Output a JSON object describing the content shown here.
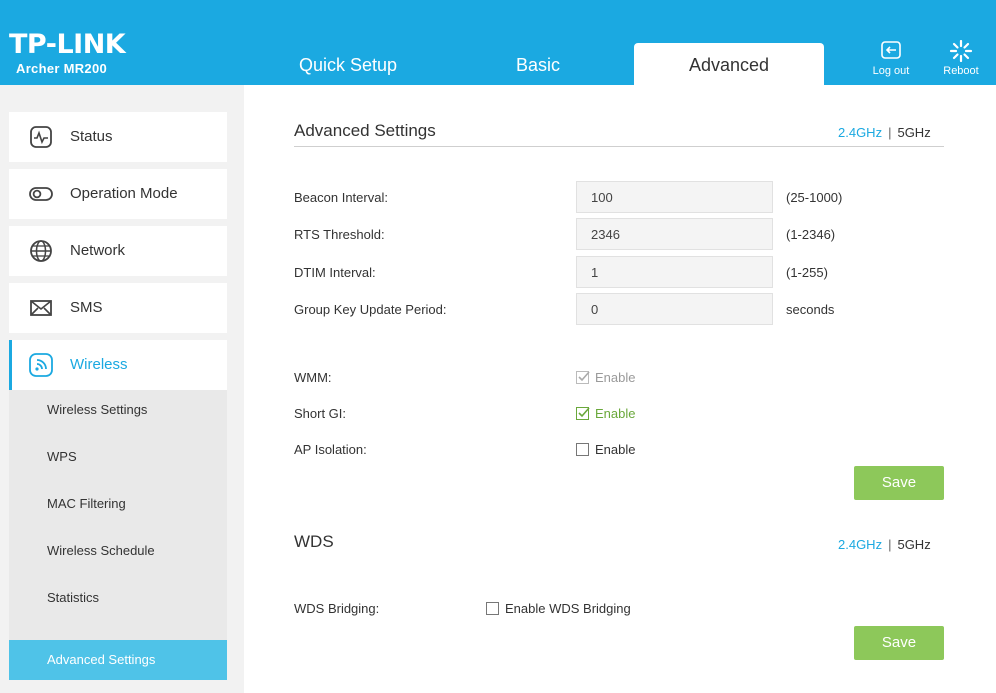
{
  "brand": {
    "logo": "TP-LINK",
    "model": "Archer MR200"
  },
  "tabs": [
    {
      "label": "Quick Setup"
    },
    {
      "label": "Basic"
    },
    {
      "label": "Advanced"
    }
  ],
  "header_actions": {
    "logout": "Log out",
    "reboot": "Reboot"
  },
  "sidebar": {
    "items": [
      {
        "label": "Status",
        "icon": "status-icon"
      },
      {
        "label": "Operation Mode",
        "icon": "operation-mode-icon"
      },
      {
        "label": "Network",
        "icon": "globe-icon"
      },
      {
        "label": "SMS",
        "icon": "envelope-icon"
      },
      {
        "label": "Wireless",
        "icon": "wireless-icon"
      }
    ],
    "sub_items": [
      {
        "label": "Wireless Settings"
      },
      {
        "label": "WPS"
      },
      {
        "label": "MAC Filtering"
      },
      {
        "label": "Wireless Schedule"
      },
      {
        "label": "Statistics"
      },
      {
        "label": "Advanced Settings"
      }
    ]
  },
  "advanced": {
    "title": "Advanced Settings",
    "band_24": "2.4GHz",
    "band_sep": "|",
    "band_5": "5GHz",
    "fields": {
      "beacon": {
        "label": "Beacon Interval:",
        "value": "100",
        "hint": "(25-1000)"
      },
      "rts": {
        "label": "RTS Threshold:",
        "value": "2346",
        "hint": "(1-2346)"
      },
      "dtim": {
        "label": "DTIM Interval:",
        "value": "1",
        "hint": "(1-255)"
      },
      "gkup": {
        "label": "Group Key Update Period:",
        "value": "0",
        "hint": "seconds"
      }
    },
    "wmm": {
      "label": "WMM:",
      "option": "Enable",
      "checked": true,
      "disabled": true
    },
    "short_gi": {
      "label": "Short GI:",
      "option": "Enable",
      "checked": true
    },
    "ap_isolation": {
      "label": "AP Isolation:",
      "option": "Enable",
      "checked": false
    },
    "save": "Save"
  },
  "wds": {
    "title": "WDS",
    "band_24": "2.4GHz",
    "band_sep": "|",
    "band_5": "5GHz",
    "bridging": {
      "label": "WDS Bridging:",
      "option": "Enable WDS Bridging",
      "checked": false
    },
    "save": "Save"
  },
  "colors": {
    "brand_blue": "#1ba9e1",
    "save_green": "#8dc85a",
    "sub_active": "#4fc3e8",
    "enabled_green": "#6aa83b"
  }
}
